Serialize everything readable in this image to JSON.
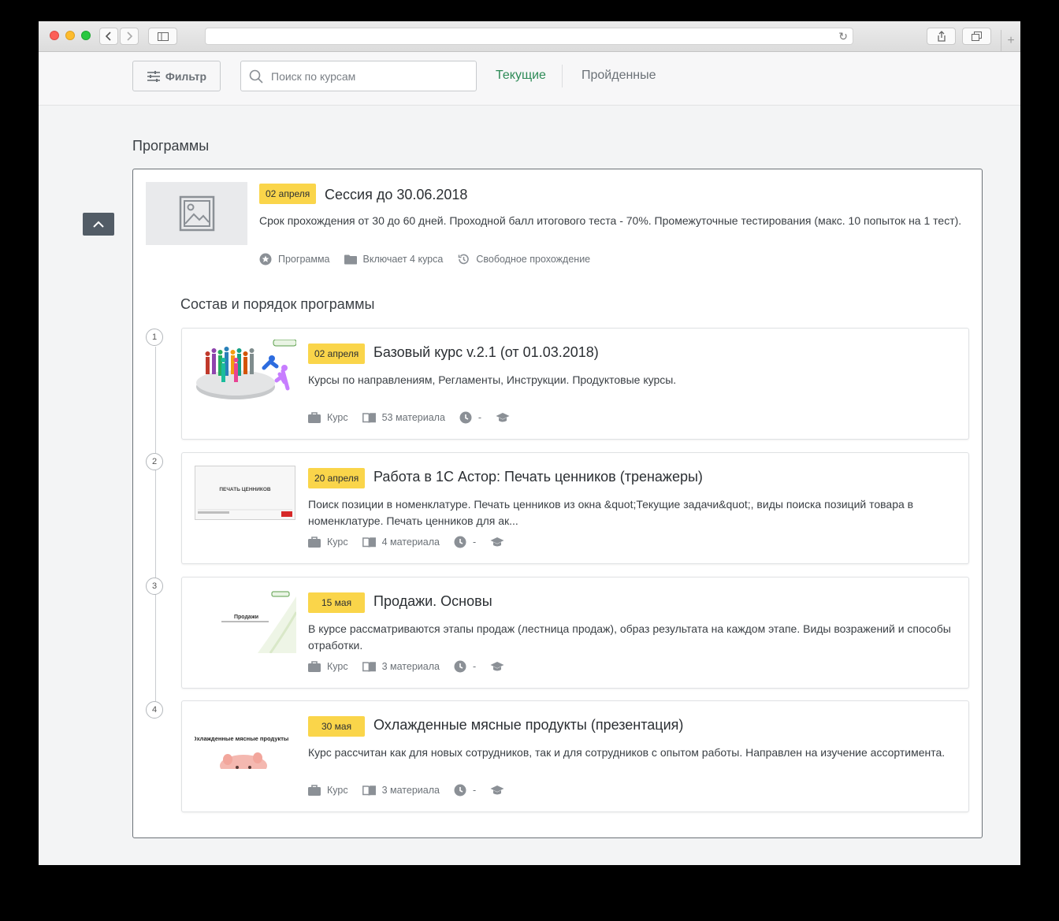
{
  "toolbar": {
    "filter_label": "Фильтр",
    "search_placeholder": "Поиск по курсам",
    "tab_current": "Текущие",
    "tab_completed": "Пройденные"
  },
  "section_title": "Программы",
  "program": {
    "date_badge": "02 апреля",
    "title": "Сессия до 30.06.2018",
    "description": "Срок прохождения от 30 до 60 дней. Проходной балл итогового теста - 70%. Промежуточные тестирования (макс. 10 попыток на 1 тест).",
    "meta": {
      "type": "Программа",
      "includes": "Включает 4 курса",
      "mode": "Свободное прохождение"
    },
    "composition_title": "Состав и порядок программы"
  },
  "courses": [
    {
      "num": "1",
      "date_badge": "02 апреля",
      "title": "Базовый курс v.2.1 (от 01.03.2018)",
      "description": "Курсы по направлениям, Регламенты, Инструкции. Продуктовые курсы.",
      "type": "Курс",
      "materials": "53 материала",
      "duration": "-"
    },
    {
      "num": "2",
      "date_badge": "20 апреля",
      "title": "Работа в 1С Астор: Печать ценников (тренажеры)",
      "description": "Поиск позиции в номенклатуре. Печать ценников из окна &quot;Текущие задачи&quot;, виды поиска позиций товара в номенклатуре. Печать ценников для ак...",
      "type": "Курс",
      "materials": "4 материала",
      "duration": "-",
      "thumb_text": "ПЕЧАТЬ ЦЕННИКОВ"
    },
    {
      "num": "3",
      "date_badge": "15 мая",
      "title": "Продажи. Основы",
      "description": "В курсе рассматриваются этапы продаж (лестница продаж), образ результата на каждом этапе. Виды возражений и способы отработки.",
      "type": "Курс",
      "materials": "3 материала",
      "duration": "-",
      "thumb_text": "Продажи"
    },
    {
      "num": "4",
      "date_badge": "30 мая",
      "title": "Охлажденные мясные продукты (презентация)",
      "description": "Курс рассчитан как для новых сотрудников, так и для сотрудников с опытом работы. Направлен на изучение ассортимента.",
      "type": "Курс",
      "materials": "3 материала",
      "duration": "-",
      "thumb_text": "Охлажденные мясные продукты"
    }
  ],
  "colors": {
    "badge": "#fad54a",
    "active_tab": "#2e8b57",
    "collapse_button": "#525c66"
  },
  "icons": [
    "filter-icon",
    "search-icon",
    "image-placeholder-icon",
    "star-icon",
    "folder-icon",
    "history-icon",
    "briefcase-icon",
    "book-icon",
    "clock-icon",
    "graduation-cap-icon",
    "chevron-up-icon"
  ]
}
